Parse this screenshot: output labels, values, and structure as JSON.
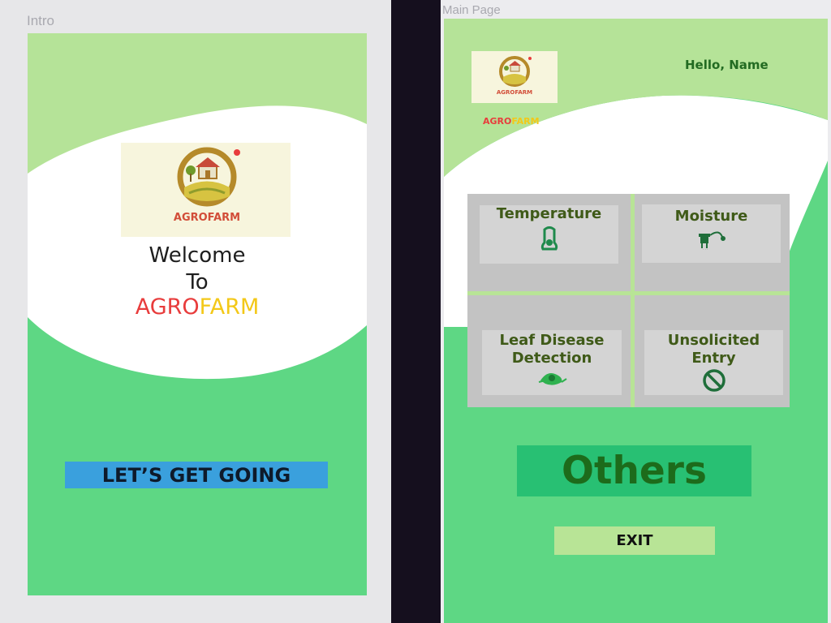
{
  "intro": {
    "artboard_label": "Intro",
    "logo_text": "AGROFARM",
    "welcome_line1": "Welcome",
    "welcome_line2": "To",
    "brand_part1": "AGRO",
    "brand_part2": "FARM",
    "cta_label": "LET’S GET GOING"
  },
  "main": {
    "artboard_label": "Main Page",
    "greeting": "Hello, Name",
    "brand_part1": "AGRO",
    "brand_part2": "FARM",
    "tiles": [
      {
        "label": "Temperature",
        "icon": "thermometer-icon"
      },
      {
        "label": "Moisture",
        "icon": "moisture-sensor-icon"
      },
      {
        "label": "Leaf Disease Detection",
        "icon": "leaf-bug-icon"
      },
      {
        "label": "Unsolicited Entry",
        "icon": "prohibited-icon"
      }
    ],
    "others_label": "Others",
    "exit_label": "EXIT"
  },
  "colors": {
    "green_main": "#5ed784",
    "green_light": "#b8e496",
    "brand_red": "#e83c3c",
    "brand_yellow": "#f3c818",
    "cta_blue": "#3aa0dd",
    "others_green": "#28c073"
  }
}
